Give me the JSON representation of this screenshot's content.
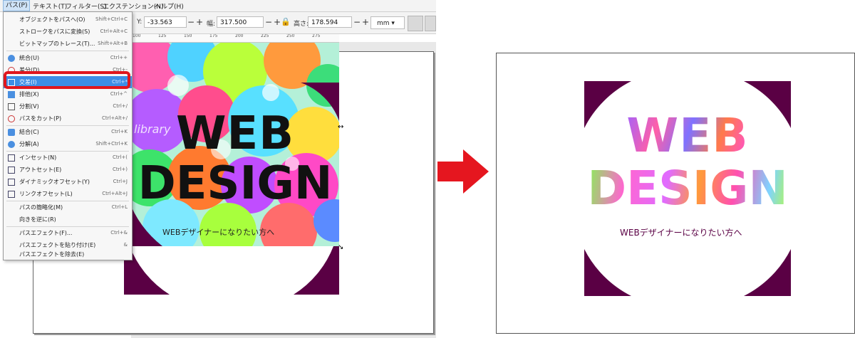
{
  "menubar": {
    "items": [
      "パス(P)",
      "テキスト(T)",
      "フィルター(S)",
      "エクステンション(N)",
      "ヘルプ(H)"
    ]
  },
  "toolbar": {
    "y_label": "Y:",
    "y_value": "-33.563",
    "w_label": "幅:",
    "w_value": "317.500",
    "h_label": "高さ:",
    "h_value": "178.594",
    "unit": "mm",
    "minus": "−",
    "plus": "+"
  },
  "ruler": {
    "ticks": [
      "100",
      "125",
      "150",
      "175",
      "200",
      "225",
      "250",
      "275"
    ]
  },
  "path_menu": {
    "items": [
      {
        "label": "オブジェクトをパスへ(O)",
        "shortcut": "Shift+Ctrl+C"
      },
      {
        "label": "ストロークをパスに変換(S)",
        "shortcut": "Ctrl+Alt+C"
      },
      {
        "label": "ビットマップのトレース(T)...",
        "shortcut": "Shift+Alt+B"
      },
      {
        "label": "統合(U)",
        "shortcut": "Ctrl++"
      },
      {
        "label": "差分(D)",
        "shortcut": "Ctrl+-"
      },
      {
        "label": "交差(I)",
        "shortcut": "Ctrl+*"
      },
      {
        "label": "排他(X)",
        "shortcut": "Ctrl+^"
      },
      {
        "label": "分割(V)",
        "shortcut": "Ctrl+/"
      },
      {
        "label": "パスをカット(P)",
        "shortcut": "Ctrl+Alt+/"
      },
      {
        "label": "結合(C)",
        "shortcut": "Ctrl+K"
      },
      {
        "label": "分解(A)",
        "shortcut": "Shift+Ctrl+K"
      },
      {
        "label": "インセット(N)",
        "shortcut": "Ctrl+("
      },
      {
        "label": "アウトセット(E)",
        "shortcut": "Ctrl+)"
      },
      {
        "label": "ダイナミックオフセット(Y)",
        "shortcut": "Ctrl+J"
      },
      {
        "label": "リンクオフセット(L)",
        "shortcut": "Ctrl+Alt+J"
      },
      {
        "label": "パスの簡略化(M)",
        "shortcut": "Ctrl+L"
      },
      {
        "label": "向きを逆に(R)",
        "shortcut": ""
      },
      {
        "label": "パスエフェクト(F)...",
        "shortcut": "Ctrl+&"
      },
      {
        "label": "パスエフェクトを貼り付け(E)",
        "shortcut": "&"
      },
      {
        "label": "パスエフェクトを除去(E)",
        "shortcut": ""
      }
    ]
  },
  "design": {
    "title_line1": "WEB",
    "title_line2": "DESIGN",
    "subtitle": "WEBデザイナーになりたい方へ",
    "watermark": "library",
    "accent_color": "#5a0044",
    "highlight_color": "#e0161d"
  },
  "result": {
    "title_line1": "WEB",
    "title_line2": "DESIGN",
    "subtitle": "WEBデザイナーになりたい方へ"
  }
}
